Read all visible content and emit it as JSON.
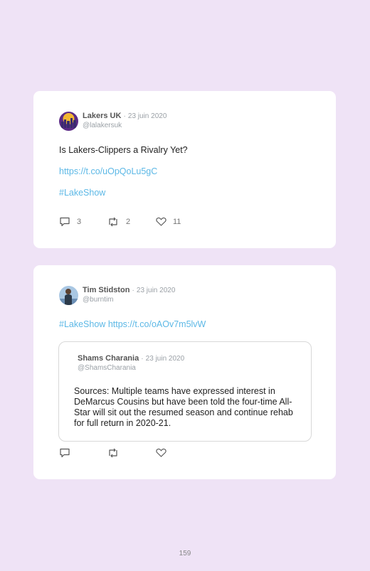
{
  "tweets": [
    {
      "author": "Lakers UK",
      "date": "23 juin 2020",
      "handle": "@lalakersuk",
      "text": "Is Lakers-Clippers a Rivalry Yet?",
      "link": "https://t.co/uOpQoLu5gC",
      "hashtag": "#LakeShow",
      "replies": "3",
      "retweets": "2",
      "likes": "11"
    },
    {
      "author": "Tim Stidston",
      "date": "23 juin 2020",
      "handle": "@burntim",
      "hashtag": "#LakeShow",
      "link": "https://t.co/oAOv7m5lvW",
      "quoted": {
        "author": "Shams Charania",
        "date": "23 juin 2020",
        "handle": "@ShamsCharania",
        "text": "Sources: Multiple teams have expressed interest in DeMarcus Cousins but have been told the four-time All-Star will sit out the resumed season and continue rehab for full return in 2020-21."
      }
    }
  ],
  "separator": "·",
  "page_number": "159",
  "colors": {
    "background": "#efe3f6",
    "link": "#5cb8e6"
  }
}
